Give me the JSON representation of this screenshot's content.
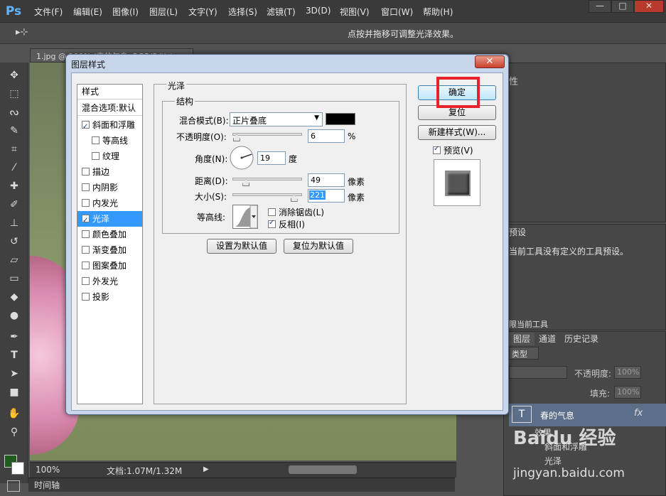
{
  "app": {
    "logo": "Ps"
  },
  "menu": [
    "文件(F)",
    "编辑(E)",
    "图像(I)",
    "图层(L)",
    "文字(Y)",
    "选择(S)",
    "滤镜(T)",
    "3D(D)",
    "视图(V)",
    "窗口(W)",
    "帮助(H)"
  ],
  "window_buttons": {
    "min": "—",
    "max": "□",
    "close": "✕"
  },
  "options_bar": {
    "tool_glyph": "▸⊹",
    "hint": "点按并拖移可调整光泽效果。"
  },
  "document": {
    "tab": "1.jpg @ 100% (春的气息, RGB/8#) *",
    "zoom": "100%",
    "doc_size": "文档:1.07M/1.32M",
    "timeline": "时间轴"
  },
  "panels": {
    "properties_title": "性",
    "presets_title": "预设",
    "presets_text": "当前工具没有定义的工具预设。",
    "presets_footer": "限当前工具",
    "layers_tabs": [
      "图层",
      "通道",
      "历史记录"
    ],
    "kind_label": "类型",
    "opacity_label": "不透明度:",
    "opacity_value": "100%",
    "fill_label": "填充:",
    "fill_value": "100%",
    "layer_name": "春的气息",
    "layer_thumb": "T",
    "fx": "fx",
    "effects_label": "效果",
    "effect_bevel": "斜面和浮雕",
    "effect_satin": "光泽"
  },
  "watermark": {
    "brand": "Baidu 经验",
    "url": "jingyan.baidu.com"
  },
  "dialog": {
    "title": "图层样式",
    "close": "✕",
    "styles_header": "样式",
    "blend_options": "混合选项:默认",
    "style_items": [
      {
        "label": "斜面和浮雕",
        "checked": true,
        "indent": false
      },
      {
        "label": "等高线",
        "checked": false,
        "indent": true
      },
      {
        "label": "纹理",
        "checked": false,
        "indent": true
      },
      {
        "label": "描边",
        "checked": false,
        "indent": false
      },
      {
        "label": "内阴影",
        "checked": false,
        "indent": false
      },
      {
        "label": "内发光",
        "checked": false,
        "indent": false
      },
      {
        "label": "光泽",
        "checked": true,
        "indent": false,
        "selected": true
      },
      {
        "label": "颜色叠加",
        "checked": false,
        "indent": false
      },
      {
        "label": "渐变叠加",
        "checked": false,
        "indent": false
      },
      {
        "label": "图案叠加",
        "checked": false,
        "indent": false
      },
      {
        "label": "外发光",
        "checked": false,
        "indent": false
      },
      {
        "label": "投影",
        "checked": false,
        "indent": false
      }
    ],
    "satin": {
      "group_title": "光泽",
      "structure_title": "结构",
      "blend_mode_label": "混合模式(B):",
      "blend_mode_value": "正片叠底",
      "blend_color": "#000000",
      "opacity_label": "不透明度(O):",
      "opacity_value": "6",
      "opacity_unit": "%",
      "angle_label": "角度(N):",
      "angle_value": "19",
      "angle_unit": "度",
      "distance_label": "距离(D):",
      "distance_value": "49",
      "distance_unit": "像素",
      "size_label": "大小(S):",
      "size_value": "221",
      "size_unit": "像素",
      "contour_label": "等高线:",
      "antialias_label": "消除锯齿(L)",
      "antialias_checked": false,
      "invert_label": "反相(I)",
      "invert_checked": true,
      "set_default": "设置为默认值",
      "reset_default": "复位为默认值"
    },
    "buttons": {
      "ok": "确定",
      "reset": "复位",
      "new_style": "新建样式(W)...",
      "preview_label": "预览(V)",
      "preview_checked": true
    }
  },
  "colors": {
    "accent_selection": "#3399ff",
    "highlight_box": "#e8222a",
    "foreground": "#1f5a1f",
    "background": "#ffffff"
  }
}
